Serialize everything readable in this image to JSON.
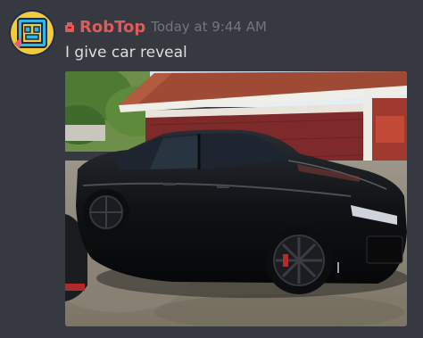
{
  "message": {
    "author": "RobTop",
    "timestamp": "Today at 9:44 AM",
    "content": "I give car reveal",
    "avatar_icon": "geometry-dash-cube-icon",
    "role_icon": "crown-icon",
    "attachment": {
      "type": "image",
      "description": "photo of black sedan parked in front of red garage"
    }
  },
  "colors": {
    "background": "#36393f",
    "username": "#e05a5a",
    "timestamp": "#72767d",
    "text": "#dcddde"
  }
}
